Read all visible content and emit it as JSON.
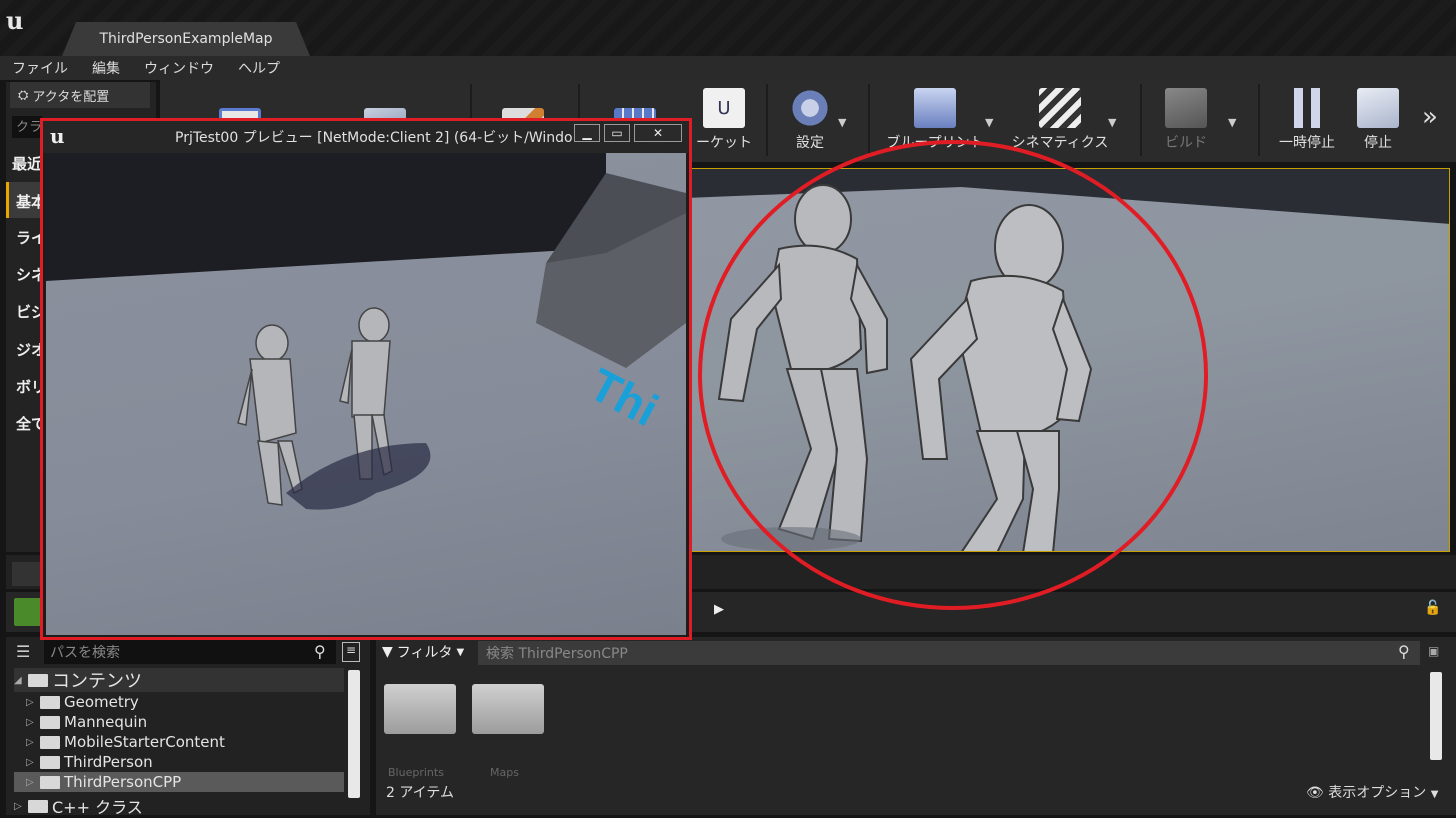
{
  "window": {
    "logo": "u",
    "doc_tab": "ThirdPersonExampleMap"
  },
  "menubar": [
    "ファイル",
    "編集",
    "ウィンドウ",
    "ヘルプ"
  ],
  "place_panel": {
    "tab_label": "アクタを配置",
    "search_placeholder": "クラ",
    "categories": [
      "最近",
      "基本",
      "ライ",
      "シネ",
      "ビジ",
      "ジオ",
      "ボリ",
      "全て"
    ]
  },
  "toolbar": {
    "items": [
      {
        "label": "",
        "icon": "save-icon"
      },
      {
        "label": "",
        "icon": "source-control-icon"
      },
      {
        "label": "",
        "icon": "modes-icon"
      },
      {
        "label": "",
        "icon": "content-icon"
      },
      {
        "label": "ーケット",
        "icon": "marketplace-icon"
      },
      {
        "label": "設定",
        "icon": "settings-icon"
      },
      {
        "label": "ブループリント",
        "icon": "blueprint-icon"
      },
      {
        "label": "シネマティクス",
        "icon": "cinematics-icon"
      },
      {
        "label": "ビルド",
        "icon": "build-icon"
      },
      {
        "label": "一時停止",
        "icon": "pause-icon"
      },
      {
        "label": "停止",
        "icon": "stop-icon"
      }
    ],
    "more": "»"
  },
  "preview_window": {
    "title": "PrjTest00 プレビュー [NetMode:Client 2]  (64-ビット/Windo",
    "logo": "u",
    "minimize": "▁",
    "maximize": "▭",
    "close": "✕",
    "floor_text": "Thi"
  },
  "folder_tree": {
    "search_placeholder": "パスを検索",
    "root": "コンテンツ",
    "items": [
      "Geometry",
      "Mannequin",
      "MobileStarterContent",
      "ThirdPerson",
      "ThirdPersonCPP"
    ],
    "selected": "ThirdPersonCPP",
    "next_root": "C++ クラス"
  },
  "asset_panel": {
    "filter_label": "フィルタ",
    "search_placeholder": "検索 ThirdPersonCPP",
    "folders": [
      "Blueprints",
      "Maps"
    ],
    "count": "2 アイテム",
    "view_options": "表示オプション"
  },
  "colors": {
    "highlight_red": "#e01d24",
    "viewport_border": "#c8a000",
    "add_new_green": "#4a8a2a"
  }
}
